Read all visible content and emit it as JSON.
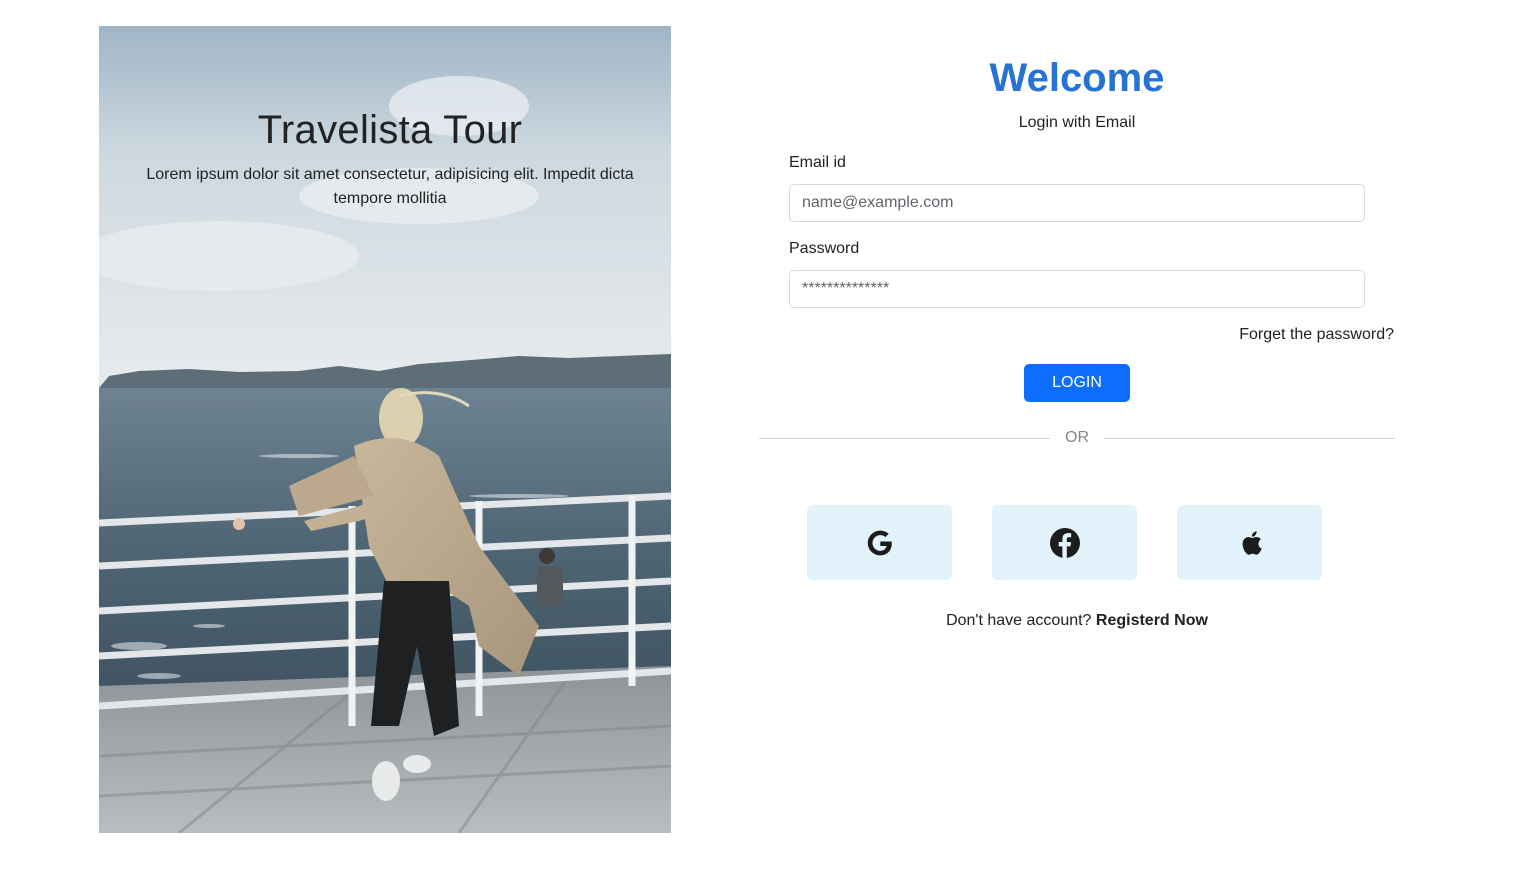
{
  "hero": {
    "title": "Travelista Tour",
    "description": "Lorem ipsum dolor sit amet consectetur, adipisicing elit. Impedit dicta tempore mollitia"
  },
  "login": {
    "heading": "Welcome",
    "subtitle": "Login with Email",
    "email_label": "Email id",
    "email_placeholder": "name@example.com",
    "password_label": "Password",
    "password_placeholder": "**************",
    "forgot_link": "Forget the password?",
    "login_button": "LOGIN",
    "divider_text": "OR",
    "social_icons": [
      "google-icon",
      "facebook-icon",
      "apple-icon"
    ],
    "register_prompt": "Don't have account?",
    "register_link": "Registerd Now"
  },
  "colors": {
    "heading": "#2673d4",
    "primary_button": "#0d6efd",
    "social_button_bg": "#e3f3fc"
  }
}
